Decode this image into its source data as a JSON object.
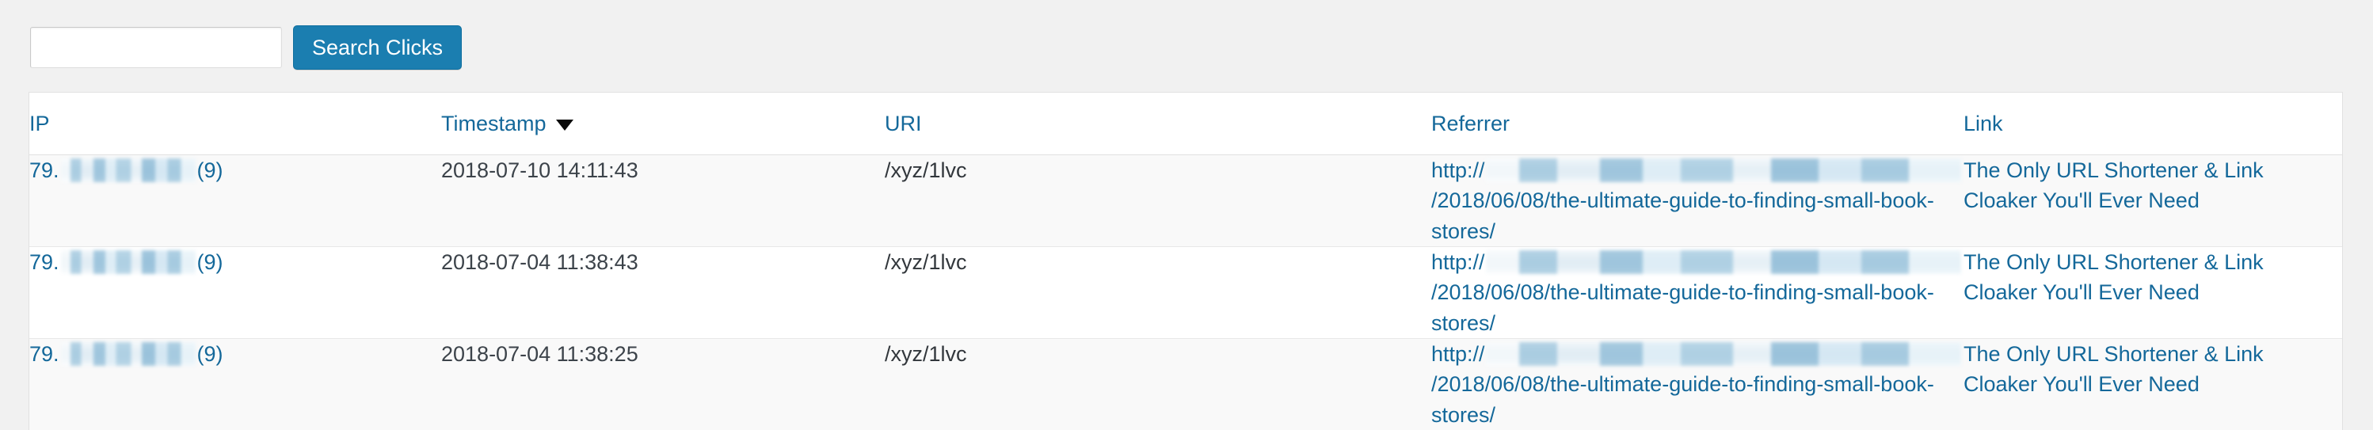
{
  "search": {
    "value": "",
    "placeholder": "",
    "button_label": "Search Clicks"
  },
  "table": {
    "columns": [
      {
        "key": "ip",
        "label": "IP",
        "sorted": false
      },
      {
        "key": "timestamp",
        "label": "Timestamp",
        "sorted": true,
        "sort_direction": "desc",
        "sort_glyph": "▼"
      },
      {
        "key": "uri",
        "label": "URI",
        "sorted": false
      },
      {
        "key": "referrer",
        "label": "Referrer",
        "sorted": false
      },
      {
        "key": "link",
        "label": "Link",
        "sorted": false
      }
    ],
    "rows": [
      {
        "ip_prefix": "79.",
        "ip_redacted": true,
        "ip_count": "(9)",
        "timestamp": "2018-07-10 14:11:43",
        "uri": "/xyz/1lvc",
        "referrer_scheme": "http://",
        "referrer_host_redacted": true,
        "referrer_path": "/2018/06/08/the-ultimate-guide-to-finding-small-book-stores/",
        "link_title": "The Only URL Shortener & Link Cloaker You'll Ever Need"
      },
      {
        "ip_prefix": "79.",
        "ip_redacted": true,
        "ip_count": "(9)",
        "timestamp": "2018-07-04 11:38:43",
        "uri": "/xyz/1lvc",
        "referrer_scheme": "http://",
        "referrer_host_redacted": true,
        "referrer_path": "/2018/06/08/the-ultimate-guide-to-finding-small-book-stores/",
        "link_title": "The Only URL Shortener & Link Cloaker You'll Ever Need"
      },
      {
        "ip_prefix": "79.",
        "ip_redacted": true,
        "ip_count": "(9)",
        "timestamp": "2018-07-04 11:38:25",
        "uri": "/xyz/1lvc",
        "referrer_scheme": "http://",
        "referrer_host_redacted": true,
        "referrer_path": "/2018/06/08/the-ultimate-guide-to-finding-small-book-stores/",
        "link_title": "The Only URL Shortener & Link Cloaker You'll Ever Need"
      }
    ]
  },
  "colors": {
    "page_background": "#f1f1f1",
    "link_blue": "#14689a",
    "button_blue": "#1b7eb0",
    "row_alt_background": "#f9f9f9",
    "border": "#e1e1e1"
  }
}
